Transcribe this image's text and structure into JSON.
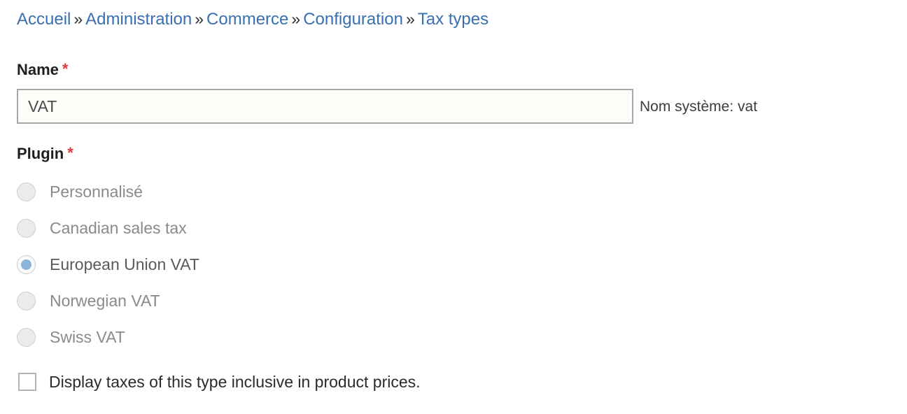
{
  "breadcrumb": {
    "separator": "»",
    "items": [
      {
        "label": "Accueil"
      },
      {
        "label": "Administration"
      },
      {
        "label": "Commerce"
      },
      {
        "label": "Configuration"
      },
      {
        "label": "Tax types"
      }
    ]
  },
  "form": {
    "name_field": {
      "label": "Name",
      "required_marker": "*",
      "value": "VAT",
      "placeholder": "",
      "machine_name_text": "Nom système: vat"
    },
    "plugin_field": {
      "label": "Plugin",
      "required_marker": "*",
      "selected": "European Union VAT",
      "options": [
        {
          "label": "Personnalisé",
          "selected": false
        },
        {
          "label": "Canadian sales tax",
          "selected": false
        },
        {
          "label": "European Union VAT",
          "selected": true
        },
        {
          "label": "Norwegian VAT",
          "selected": false
        },
        {
          "label": "Swiss VAT",
          "selected": false
        }
      ]
    },
    "display_inclusive_checkbox": {
      "label": "Display taxes of this type inclusive in product prices.",
      "checked": false
    }
  },
  "colors": {
    "link": "#3a6fb0",
    "required": "#e0393e",
    "radio_selected_dot": "#8ab4d8",
    "radio_fill": "#ebebeb",
    "input_border": "#a8a8a8",
    "input_background": "#fdfdfa",
    "page_background": "#ffffff"
  }
}
